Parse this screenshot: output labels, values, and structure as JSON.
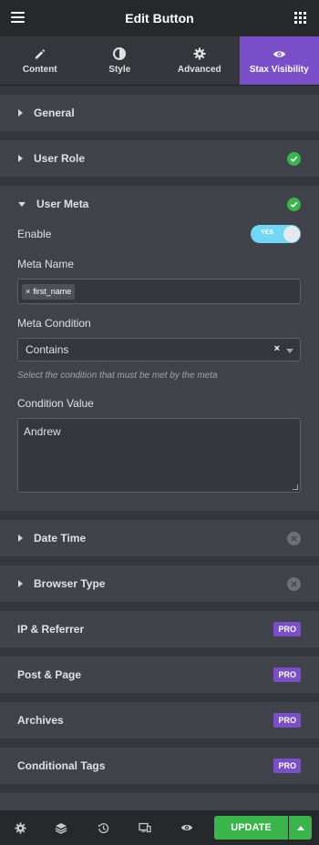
{
  "header": {
    "title": "Edit Button"
  },
  "tabs": [
    {
      "label": "Content",
      "icon": "pencil-icon",
      "active": false
    },
    {
      "label": "Style",
      "icon": "half-circle-icon",
      "active": false
    },
    {
      "label": "Advanced",
      "icon": "gear-icon",
      "active": false
    },
    {
      "label": "Stax Visibility",
      "icon": "eye-icon",
      "active": true
    }
  ],
  "sections": {
    "general": {
      "title": "General"
    },
    "user_role": {
      "title": "User Role",
      "status": "enabled"
    },
    "user_meta": {
      "title": "User Meta",
      "status": "enabled",
      "enable_label": "Enable",
      "toggle_text": "YES",
      "meta_name_label": "Meta Name",
      "meta_name_tag": "first_name",
      "tag_remove": "×",
      "meta_condition_label": "Meta Condition",
      "meta_condition_value": "Contains",
      "meta_condition_help": "Select the condition that must be met by the meta",
      "condition_value_label": "Condition Value",
      "condition_value": "Andrew"
    },
    "date_time": {
      "title": "Date Time",
      "status": "disabled"
    },
    "browser_type": {
      "title": "Browser Type",
      "status": "disabled"
    },
    "ip_referrer": {
      "title": "IP & Referrer",
      "badge": "PRO"
    },
    "post_page": {
      "title": "Post & Page",
      "badge": "PRO"
    },
    "archives": {
      "title": "Archives",
      "badge": "PRO"
    },
    "conditional_tags": {
      "title": "Conditional Tags",
      "badge": "PRO"
    }
  },
  "footer": {
    "update_label": "UPDATE"
  },
  "colors": {
    "accent": "#7b4fc9",
    "success": "#39b54a",
    "toggle_on": "#71d7f7",
    "panel": "#404349",
    "background": "#34383c",
    "header": "#26292c"
  }
}
